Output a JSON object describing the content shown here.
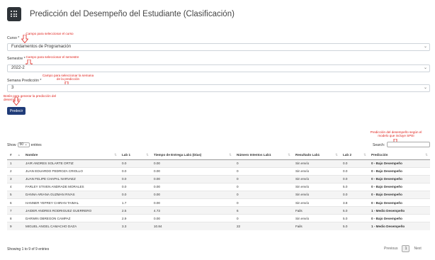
{
  "header": {
    "title": "Predicción del Desempeño del Estudiante (Clasificación)",
    "logo_icon": "dice-icon"
  },
  "form": {
    "curso": {
      "label": "Curso *",
      "value": "Fundamentos de Programación"
    },
    "semestre": {
      "label": "Semestre *",
      "value": "2022-2"
    },
    "semana": {
      "label": "Semana Predicción *",
      "value": "3"
    },
    "predict_button": "Predecir"
  },
  "annotations": {
    "curso": "Campo para seleccionar el curso",
    "semestre": "Campo para seleccionar el semestre",
    "semana_1": "Campo para seleccionar la semana",
    "semana_2": "de la predicción",
    "boton": "Botón para generar la predicción del desempeño",
    "pred_1": "Predicción del desempeño según el",
    "pred_2": "modelo que incluye SPEI",
    "color": "#e0221c"
  },
  "table_controls": {
    "show": "Show",
    "entries_value": "50",
    "entries": "entries",
    "search": "Search:",
    "info": "Showing 1 to 9 of 9 entries",
    "previous": "Previous",
    "page": "1",
    "next": "Next"
  },
  "columns": [
    "#",
    "Nombre",
    "Lab 1",
    "Tiempo de Entrega Lab1 (Días)",
    "Número Intentos Lab1",
    "Resultado Lab1",
    "Lab 2",
    "Predicción"
  ],
  "rows": [
    [
      "1",
      "JAIR ANDRES SOLARTE ORTIZ",
      "0.0",
      "0.00",
      "0",
      "Sin envío",
      "0.0",
      "0 - Bajo Desempeño"
    ],
    [
      "2",
      "JUAN EDUARDO PEDROZA CRIOLLO",
      "0.0",
      "0.00",
      "0",
      "Sin envío",
      "0.0",
      "0 - Bajo Desempeño"
    ],
    [
      "3",
      "JUAN FELIPE CHAPAL NARVAEZ",
      "0.0",
      "0.00",
      "0",
      "Sin envío",
      "0.0",
      "0 - Bajo Desempeño"
    ],
    [
      "4",
      "FARLEY STIVEN ANDRADE MORALES",
      "0.0",
      "0.00",
      "0",
      "Sin envío",
      "5.0",
      "0 - Bajo Desempeño"
    ],
    [
      "5",
      "DANNA ARIANA GUZMAN RIVAS",
      "0.0",
      "0.00",
      "0",
      "Sin envío",
      "0.0",
      "0 - Bajo Desempeño"
    ],
    [
      "6",
      "HANNER YEFREY CHIRAN TAIMAL",
      "1.7",
      "0.00",
      "0",
      "Sin envío",
      "3.8",
      "0 - Bajo Desempeño"
    ],
    [
      "7",
      "JAIDER ANDRES RODRIGUEZ GUERRERO",
      "2.5",
      "4.73",
      "6",
      "Fails",
      "5.0",
      "1 - Medio Desempeño"
    ],
    [
      "8",
      "DARWIN OBREGON CAMPAZ",
      "2.9",
      "0.00",
      "0",
      "Sin envío",
      "5.0",
      "0 - Bajo Desempeño"
    ],
    [
      "9",
      "MIGUEL ANGEL CAMACHO DAZA",
      "3.3",
      "10.84",
      "22",
      "Fails",
      "5.0",
      "1 - Medio Desempeño"
    ]
  ]
}
